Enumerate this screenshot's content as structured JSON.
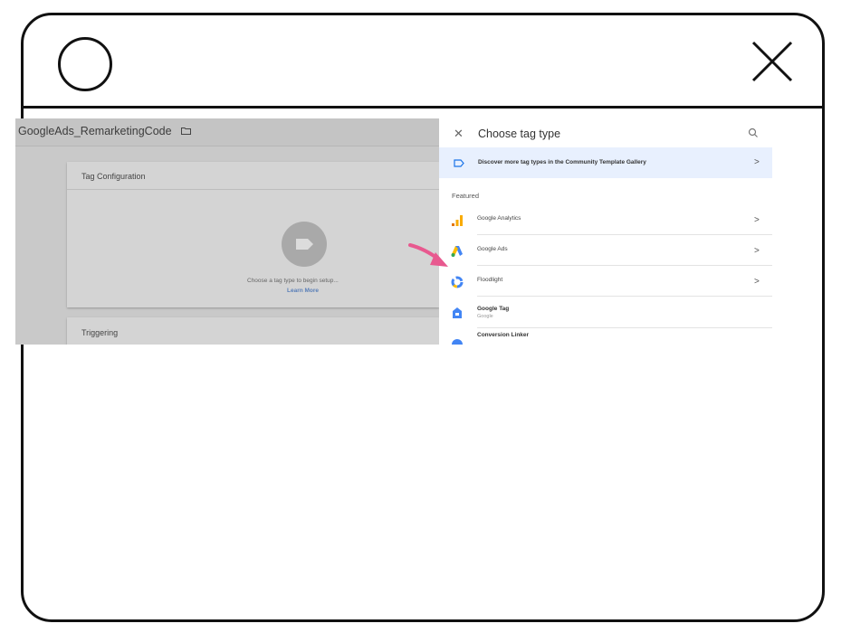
{
  "frame": {
    "left_button_icon": "circle-icon",
    "close_icon": "close-x-icon"
  },
  "editor": {
    "tag_name": "GoogleAds_RemarketingCode",
    "folder_icon": "folder-icon",
    "tag_configuration": {
      "title": "Tag Configuration",
      "prompt": "Choose a tag type to begin setup...",
      "learn_more": "Learn More"
    },
    "triggering": {
      "title": "Triggering"
    }
  },
  "panel": {
    "title": "Choose tag type",
    "close_icon": "close-icon",
    "search_icon": "search-icon",
    "community_banner": "Discover more tag types in the Community Template Gallery",
    "featured_label": "Featured",
    "items": [
      {
        "label": "Google Analytics",
        "icon": "google-analytics-icon"
      },
      {
        "label": "Google Ads",
        "icon": "google-ads-icon"
      },
      {
        "label": "Floodlight",
        "icon": "floodlight-icon"
      },
      {
        "label": "Google Tag",
        "sub": "Google",
        "icon": "google-tag-icon"
      },
      {
        "label": "Conversion Linker",
        "icon": "conversion-linker-icon"
      }
    ]
  },
  "colors": {
    "accent_blue": "#4285f4",
    "banner_bg": "#e8f0fe",
    "pointer_arrow": "#e8598f",
    "analytics_orange": "#f9ab00"
  }
}
